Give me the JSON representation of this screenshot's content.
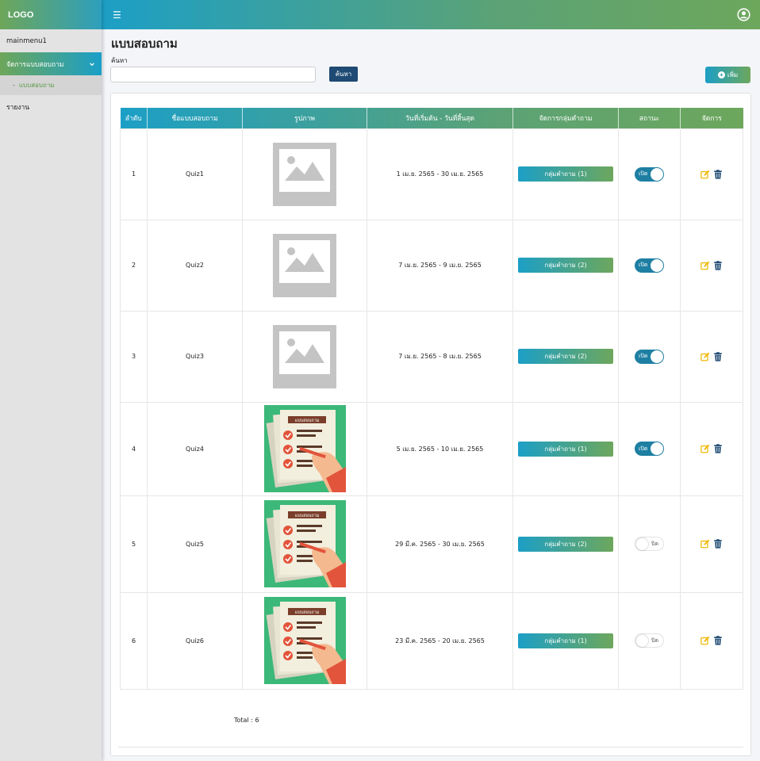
{
  "header": {
    "logo": "LOGO",
    "menu_icon": "hamburger-icon",
    "user_icon": "user-circle-icon"
  },
  "sidebar": {
    "items": [
      {
        "label": "mainmenu1"
      },
      {
        "label": "จัดการแบบสอบถาม",
        "active": true
      },
      {
        "label": "แบบสอบถาม",
        "sub": true
      },
      {
        "label": "รายงาน"
      }
    ]
  },
  "page": {
    "title": "แบบสอบถาม",
    "search_label": "ค้นหา",
    "search_value": "",
    "search_button": "ค้นหา",
    "add_button": "เพิ่ม"
  },
  "table": {
    "headers": [
      "ลำดับ",
      "ชื่อแบบสอบถาม",
      "รูปภาพ",
      "วันที่เริ่มต้น - วันที่สิ้นสุด",
      "จัดการกลุ่มคำถาม",
      "สถานะ",
      "จัดการ"
    ],
    "rows": [
      {
        "no": "1",
        "name": "Quiz1",
        "image": "placeholder",
        "dates": "1 เม.ย. 2565 - 30 เม.ย. 2565",
        "group": "กลุ่มคำถาม (1)",
        "status": "เปิด",
        "on": true
      },
      {
        "no": "2",
        "name": "Quiz2",
        "image": "placeholder",
        "dates": "7 เม.ย. 2565 - 9 เม.ย. 2565",
        "group": "กลุ่มคำถาม (2)",
        "status": "เปิด",
        "on": true
      },
      {
        "no": "3",
        "name": "Quiz3",
        "image": "placeholder",
        "dates": "7 เม.ย. 2565 - 8 เม.ย. 2565",
        "group": "กลุ่มคำถาม (2)",
        "status": "เปิด",
        "on": true
      },
      {
        "no": "4",
        "name": "Quiz4",
        "image": "quiz",
        "dates": "5 เม.ย. 2565 - 10 เม.ย. 2565",
        "group": "กลุ่มคำถาม (1)",
        "status": "เปิด",
        "on": true
      },
      {
        "no": "5",
        "name": "Quiz5",
        "image": "quiz",
        "dates": "29 มี.ค. 2565 - 30 เม.ย. 2565",
        "group": "กลุ่มคำถาม (2)",
        "status": "ปิด",
        "on": false
      },
      {
        "no": "6",
        "name": "Quiz6",
        "image": "quiz",
        "dates": "23 มี.ค. 2565 - 20 เม.ย. 2565",
        "group": "กลุ่มคำถาม (1)",
        "status": "ปิด",
        "on": false
      }
    ],
    "quiz_image_text": "แบบสอบถาม",
    "total": "Total : 6"
  },
  "colors": {
    "gradient_start": "#1c9fc6",
    "gradient_end": "#6da75c",
    "search_button": "#1e4a73",
    "edit_icon": "#f0b90b",
    "delete_icon": "#1e4a73"
  }
}
